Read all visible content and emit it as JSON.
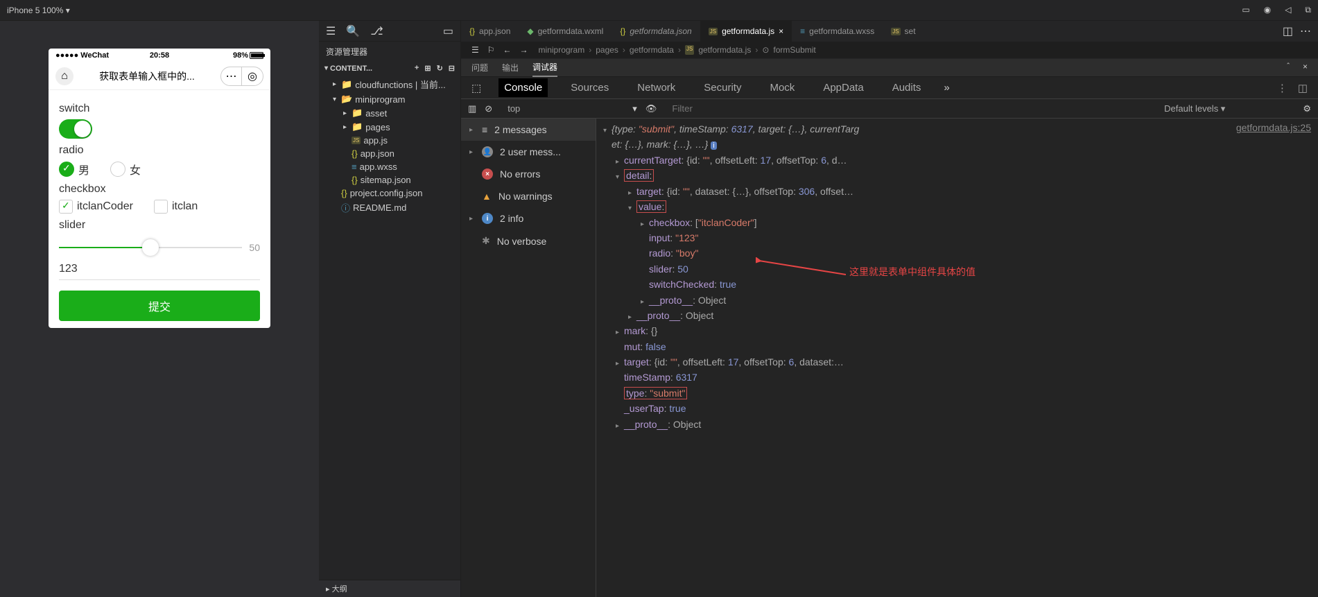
{
  "toolbar": {
    "device": "iPhone 5 100% ▾"
  },
  "phone": {
    "carrier": "●●●●● WeChat",
    "time": "20:58",
    "battery": "98%",
    "pageTitle": "获取表单输入框中的...",
    "form": {
      "switchLabel": "switch",
      "radioLabel": "radio",
      "radioMale": "男",
      "radioFemale": "女",
      "checkboxLabel": "checkbox",
      "cbItclanCoder": "itclanCoder",
      "cbItclan": "itclan",
      "sliderLabel": "slider",
      "sliderValue": "50",
      "inputValue": "123",
      "submit": "提交"
    }
  },
  "explorer": {
    "title": "资源管理器",
    "contentHeader": "CONTENT...",
    "tree": {
      "cloudfunctions": "cloudfunctions | 当前...",
      "miniprogram": "miniprogram",
      "asset": "asset",
      "pages": "pages",
      "appjs": "app.js",
      "appjson": "app.json",
      "appwxss": "app.wxss",
      "sitemap": "sitemap.json",
      "projectconfig": "project.config.json",
      "readme": "README.md"
    },
    "outline": "▸ 大纲"
  },
  "tabs": {
    "t1": "app.json",
    "t2": "getformdata.wxml",
    "t3": "getformdata.json",
    "t4": "getformdata.js",
    "t5": "getformdata.wxss",
    "t6": "set"
  },
  "breadcrumb": {
    "p1": "miniprogram",
    "p2": "pages",
    "p3": "getformdata",
    "p4": "getformdata.js",
    "p5": "formSubmit"
  },
  "devtools": {
    "topTabs": {
      "t1": "问题",
      "t2": "输出",
      "t3": "调试器"
    },
    "mainTabs": {
      "console": "Console",
      "sources": "Sources",
      "network": "Network",
      "security": "Security",
      "mock": "Mock",
      "appdata": "AppData",
      "audits": "Audits"
    },
    "filter": {
      "context": "top",
      "placeholder": "Filter",
      "levels": "Default levels ▾"
    },
    "sidebar": {
      "messages": "2 messages",
      "usermsg": "2 user mess...",
      "noerrors": "No errors",
      "nowarn": "No warnings",
      "info": "2 info",
      "noverbose": "No verbose"
    },
    "sourceLink": "getformdata.js:25",
    "console": {
      "summary1": "{type: \"submit\", timeStamp: 6317, target: {…}, currentTarg",
      "summary2": "et: {…}, mark: {…}, …}",
      "currentTarget": "currentTarget: {id: \"\", offsetLeft: 17, offsetTop: 6, d…",
      "detail": "detail:",
      "detailTarget": "target: {id: \"\", dataset: {…}, offsetTop: 306, offset…",
      "value": "value:",
      "checkbox": "checkbox: [\"itclanCoder\"]",
      "input": "input: \"123\"",
      "radio": "radio: \"boy\"",
      "slider": "slider: 50",
      "switchChecked": "switchChecked: true",
      "proto1": "__proto__: Object",
      "proto2": "__proto__: Object",
      "mark": "mark: {}",
      "mut": "mut: false",
      "target": "target: {id: \"\", offsetLeft: 17, offsetTop: 6, dataset:…",
      "timeStamp": "timeStamp: 6317",
      "type": "type: \"submit\"",
      "userTap": "_userTap: true",
      "proto3": "__proto__: Object"
    },
    "annotation": "这里就是表单中组件具体的值"
  }
}
